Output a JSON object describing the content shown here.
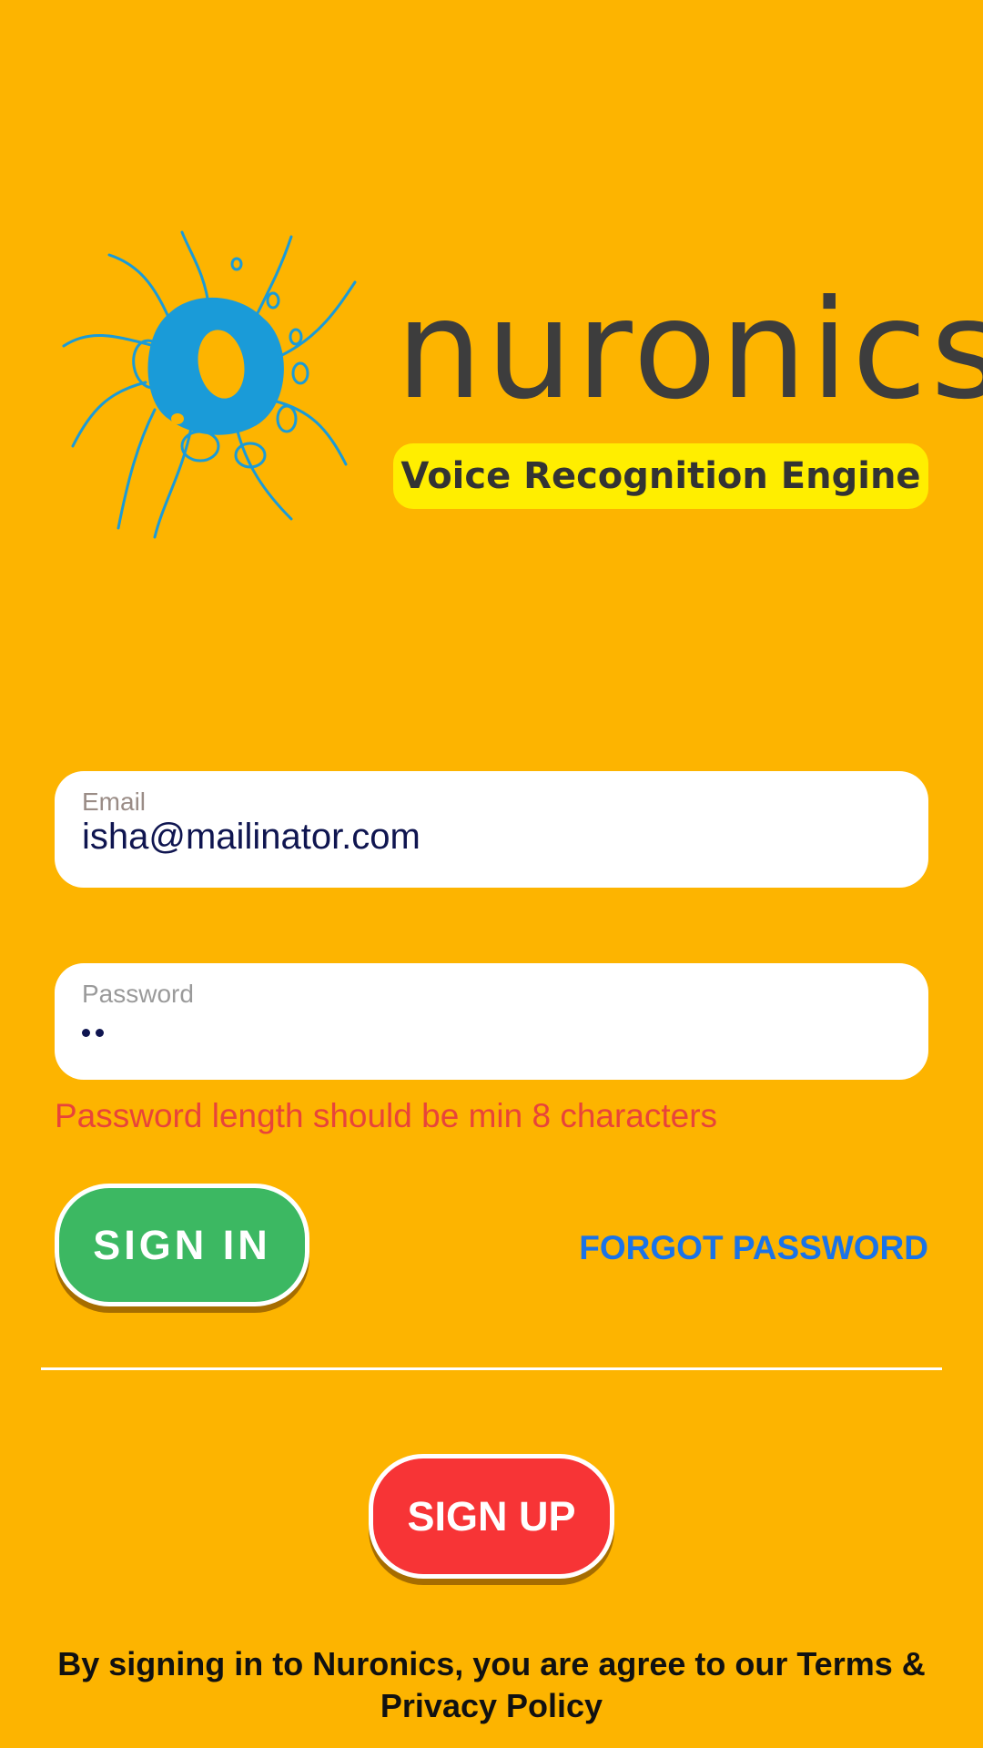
{
  "logo": {
    "brand": "nuronics",
    "tagline": "Voice Recognition Engine"
  },
  "form": {
    "email": {
      "label": "Email",
      "value": "isha@mailinator.com"
    },
    "password": {
      "label": "Password",
      "masked_length": 2
    },
    "error": "Password length should be min 8 characters"
  },
  "actions": {
    "sign_in": "SIGN IN",
    "forgot_password": "FORGOT PASSWORD",
    "sign_up": "SIGN UP"
  },
  "terms": "By signing in to Nuronics, you are agree to our Terms & Privacy Policy",
  "colors": {
    "background": "#FDB400",
    "logo_blue": "#1A9BD8",
    "sign_in": "#3CB862",
    "sign_up": "#F73436",
    "link": "#1A73E8",
    "error": "#E8443A"
  }
}
